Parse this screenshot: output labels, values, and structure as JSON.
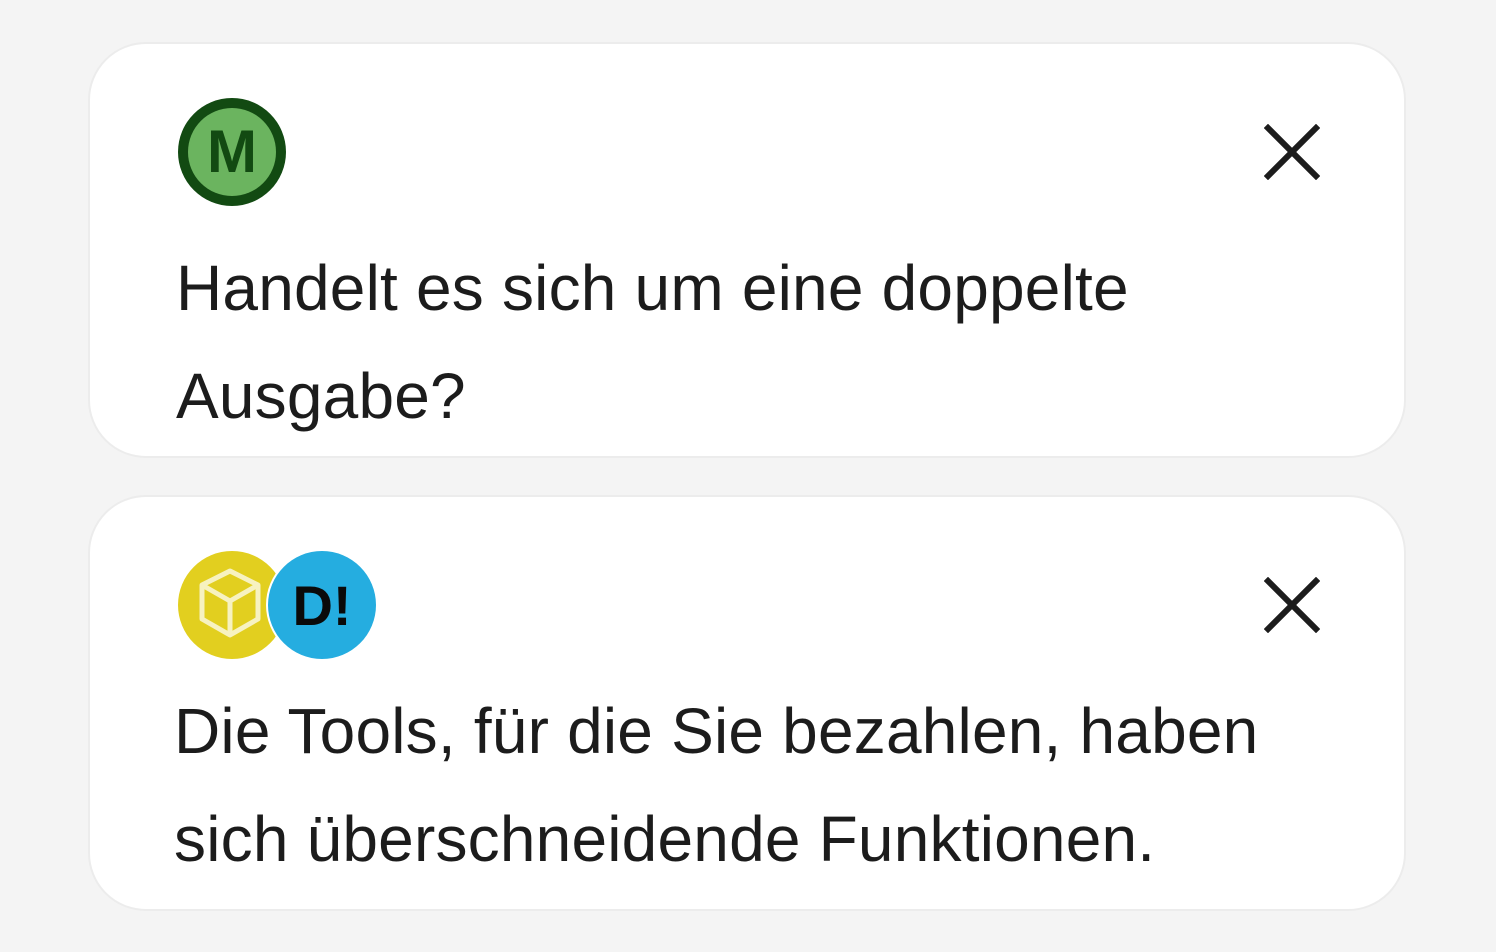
{
  "cards": [
    {
      "icons": [
        "money-logo-icon"
      ],
      "text": "Handelt es sich um eine doppelte Ausgabe?",
      "close_icon": "close-icon"
    },
    {
      "icons": [
        "package-box-icon",
        "d-exclaim-logo-icon"
      ],
      "text": "Die Tools, für die Sie bezahlen, haben sich überschneidende Funktionen.",
      "close_icon": "close-icon"
    }
  ],
  "logo_badges": {
    "card1_logo_letter": "M",
    "card2_logo_text": "D!"
  },
  "colors": {
    "background": "#f4f4f4",
    "card": "#ffffff",
    "green_dark": "#124a12",
    "green_light": "#6bb45f",
    "yellow": "#e2cf1f",
    "blue": "#25ade0",
    "text": "#1c1c1c"
  }
}
